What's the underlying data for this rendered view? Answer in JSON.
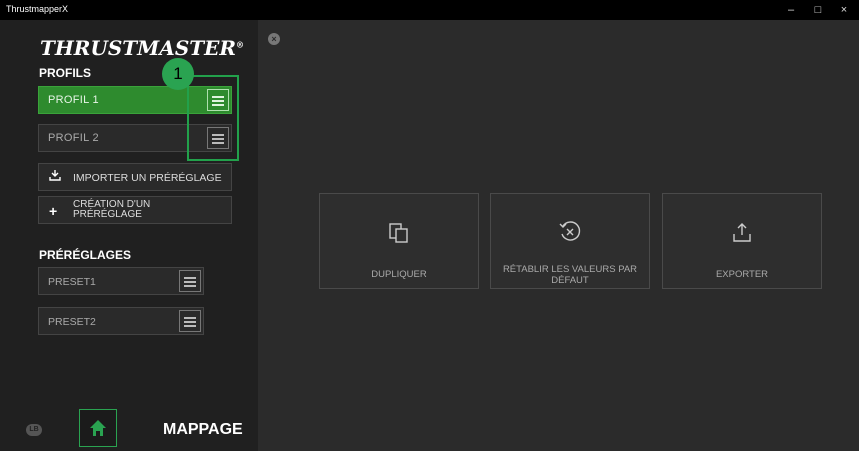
{
  "window": {
    "title": "ThrustmapperX",
    "minimize": "–",
    "maximize": "□",
    "close": "×"
  },
  "brand": {
    "logo_text": "THRUSTMASTER",
    "registered": "®"
  },
  "profiles": {
    "title": "PROFILS",
    "items": [
      {
        "label": "PROFIL 1",
        "active": true
      },
      {
        "label": "PROFIL 2",
        "active": false
      }
    ]
  },
  "actions": {
    "import": {
      "label": "IMPORTER UN PRÉRÉGLAGE",
      "icon": "import-icon"
    },
    "create": {
      "label_line1": "CRÉATION D'UN",
      "label_line2": "PRÉRÉGLAGE",
      "icon": "plus-icon"
    }
  },
  "presets": {
    "title": "PRÉRÉGLAGES",
    "items": [
      {
        "label": "PRESET1"
      },
      {
        "label": "PRESET2"
      }
    ]
  },
  "annotation": {
    "badge_number": "1",
    "color": "#22a14b"
  },
  "bottom": {
    "lb_label": "LB",
    "mode_label": "MAPPAGE"
  },
  "panel": {
    "close_icon": "close-circle-icon",
    "cards": [
      {
        "label": "DUPLIQUER",
        "icon": "duplicate-icon"
      },
      {
        "label_line1": "RÉTABLIR LES VALEURS PAR",
        "label_line2": "DÉFAUT",
        "icon": "restore-icon"
      },
      {
        "label": "EXPORTER",
        "icon": "export-icon"
      }
    ]
  },
  "colors": {
    "accent": "#2e8b2e",
    "background": "#2b2b2b",
    "sidebar": "#202020"
  }
}
